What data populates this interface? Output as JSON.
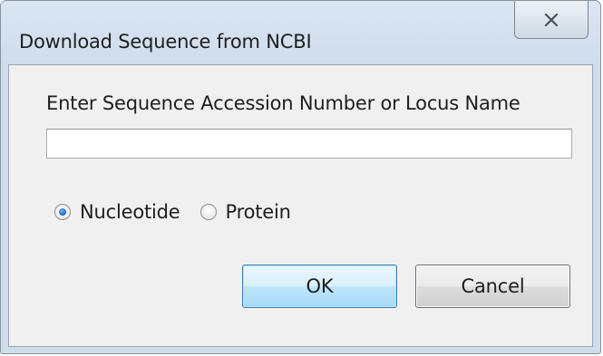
{
  "window": {
    "title": "Download Sequence from NCBI",
    "close_icon": "close-icon"
  },
  "form": {
    "prompt": "Enter Sequence Accession Number or Locus Name",
    "accession_value": "",
    "accession_placeholder": ""
  },
  "sequence_type": {
    "options": [
      {
        "label": "Nucleotide",
        "selected": true
      },
      {
        "label": "Protein",
        "selected": false
      }
    ]
  },
  "buttons": {
    "ok_label": "OK",
    "cancel_label": "Cancel"
  },
  "colors": {
    "frame": "#cfdcec",
    "client": "#f0f0f0",
    "ok_button": "#bee6fd",
    "radio_dot": "#1b63b8"
  }
}
